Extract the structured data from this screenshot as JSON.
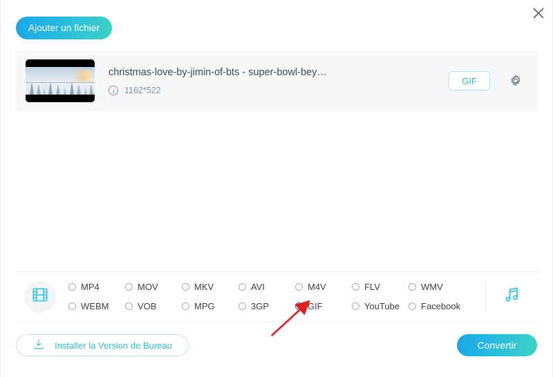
{
  "window": {
    "close_label": "×"
  },
  "toolbar": {
    "add_file_label": "Ajouter un fichier"
  },
  "file": {
    "name": "christmas-love-by-jimin-of-bts - super-bowl-bey…",
    "dimensions": "1162*522",
    "info_icon": "info-icon",
    "target_format_label": "GIF",
    "settings_icon": "gear-icon",
    "thumbnail_alt": "winter-forest-thumbnail"
  },
  "formats": {
    "video_icon": "film-strip-icon",
    "audio_icon": "music-note-icon",
    "options": [
      {
        "label": "MP4",
        "selected": false
      },
      {
        "label": "MOV",
        "selected": false
      },
      {
        "label": "MKV",
        "selected": false
      },
      {
        "label": "AVI",
        "selected": false
      },
      {
        "label": "M4V",
        "selected": false
      },
      {
        "label": "FLV",
        "selected": false
      },
      {
        "label": "WMV",
        "selected": false
      },
      {
        "label": "WEBM",
        "selected": false
      },
      {
        "label": "VOB",
        "selected": false
      },
      {
        "label": "MPG",
        "selected": false
      },
      {
        "label": "3GP",
        "selected": false
      },
      {
        "label": "GIF",
        "selected": true
      },
      {
        "label": "YouTube",
        "selected": false
      },
      {
        "label": "Facebook",
        "selected": false
      }
    ]
  },
  "footer": {
    "install_label": "Installer la Version de Bureau",
    "install_icon": "download-icon",
    "convert_label": "Convertir"
  },
  "annotation": {
    "arrow_color": "#e02020",
    "points_to": "GIF"
  },
  "colors": {
    "accent_cyan": "#2fc0c8",
    "gradient_start": "#18a6ea",
    "gradient_end": "#3ed3c2",
    "radio_selected": "#1565d8",
    "card_bg": "#f7f8f9"
  }
}
